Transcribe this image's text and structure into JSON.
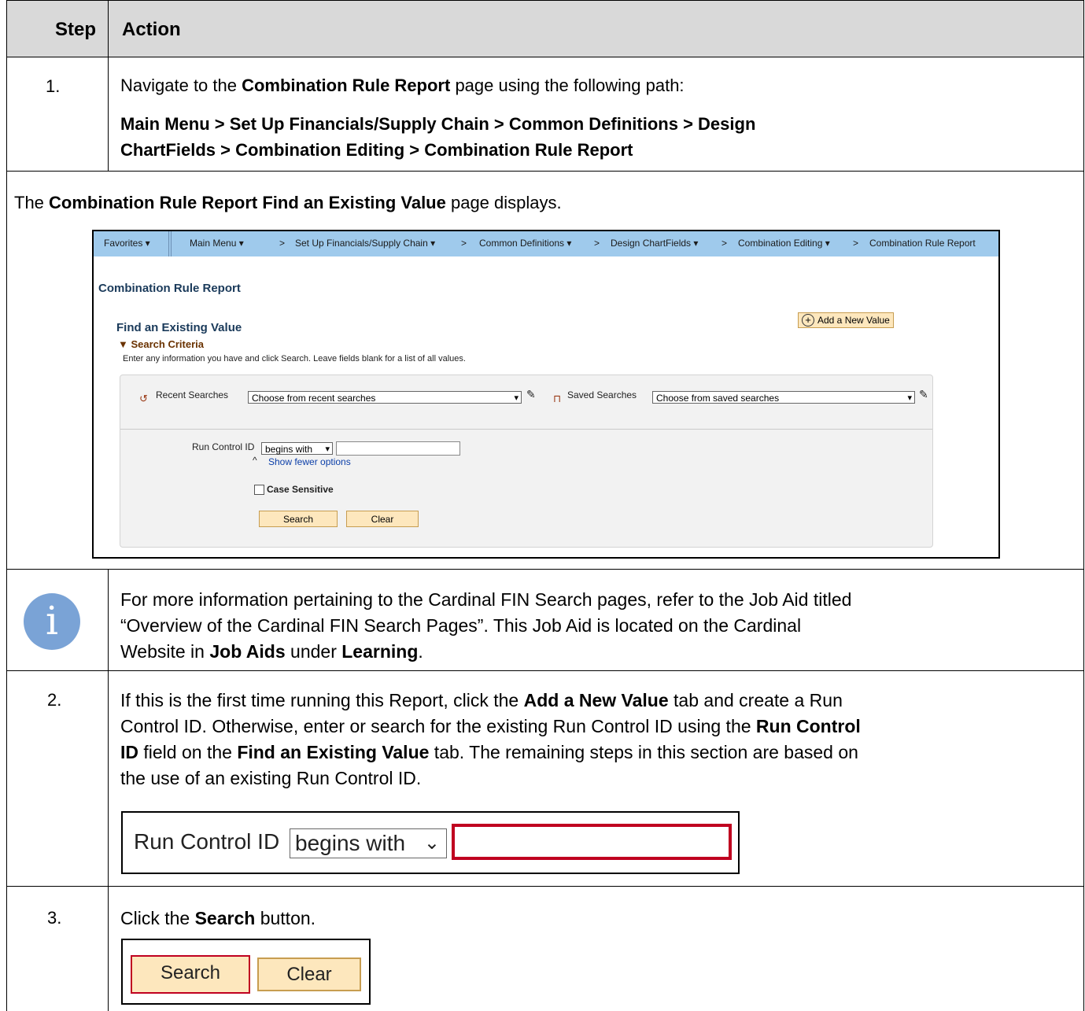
{
  "table": {
    "header_step": "Step",
    "header_action": "Action"
  },
  "row1": {
    "step": "1.",
    "line1_pre": "Navigate to the ",
    "line1_bold": "Combination Rule Report",
    "line1_post": " page using the following path:",
    "path_line1": "Main Menu > Set Up Financials/Supply Chain > Common Definitions > Design",
    "path_line2": "ChartFields > Combination Editing > Combination Rule Report"
  },
  "intro": {
    "pre": "The ",
    "bold": "Combination Rule Report Find an Existing Value",
    "post": " page displays."
  },
  "screenshot": {
    "nav": {
      "favorites": "Favorites ▾",
      "main_menu": "Main Menu ▾",
      "c1": ">",
      "setup": "Set Up Financials/Supply Chain ▾",
      "c2": ">",
      "common": "Common Definitions ▾",
      "c3": ">",
      "design": "Design ChartFields ▾",
      "c4": ">",
      "combo_edit": "Combination Editing ▾",
      "c5": ">",
      "crr": "Combination Rule Report"
    },
    "page_title": "Combination Rule Report",
    "find_title": "Find an Existing Value",
    "search_criteria": "▼ Search Criteria",
    "hint": "Enter any information you have and click Search. Leave fields blank for a list of all values.",
    "add_new": "Add a New Value",
    "recent_label": "Recent Searches",
    "recent_value": "Choose from recent searches",
    "saved_label": "Saved Searches",
    "saved_value": "Choose from saved searches",
    "run_control_label": "Run Control ID",
    "begins_with": "begins with",
    "show_fewer": "Show fewer options",
    "case_sensitive": "Case Sensitive",
    "search_btn": "Search",
    "clear_btn": "Clear"
  },
  "info": {
    "l1": "For more information pertaining to the Cardinal FIN Search pages, refer to the Job Aid titled",
    "l2": "“Overview of the Cardinal FIN Search Pages”.  This Job Aid is located on the Cardinal",
    "l3_pre": "Website in ",
    "l3_b1": "Job Aids",
    "l3_mid": " under ",
    "l3_b2": "Learning",
    "l3_post": "."
  },
  "row2": {
    "step": "2.",
    "l1_pre": "If this is the first time running this Report, click the ",
    "l1_b": "Add a New Value",
    "l1_post": " tab and create a Run",
    "l2_pre": "Control ID.  Otherwise, enter or search for the existing Run Control ID using the ",
    "l2_b": "Run Control",
    "l3_b1": "ID",
    "l3_mid": " field on the ",
    "l3_b2": "Find an Existing Value",
    "l3_post": " tab. The remaining steps in this section are based on",
    "l4": "the use of an existing Run Control ID.",
    "crop_label": "Run Control ID",
    "crop_select": "begins with"
  },
  "row3": {
    "step": "3.",
    "pre": "Click the ",
    "bold": "Search",
    "post": " button.",
    "search_btn": "Search",
    "clear_btn": "Clear"
  }
}
